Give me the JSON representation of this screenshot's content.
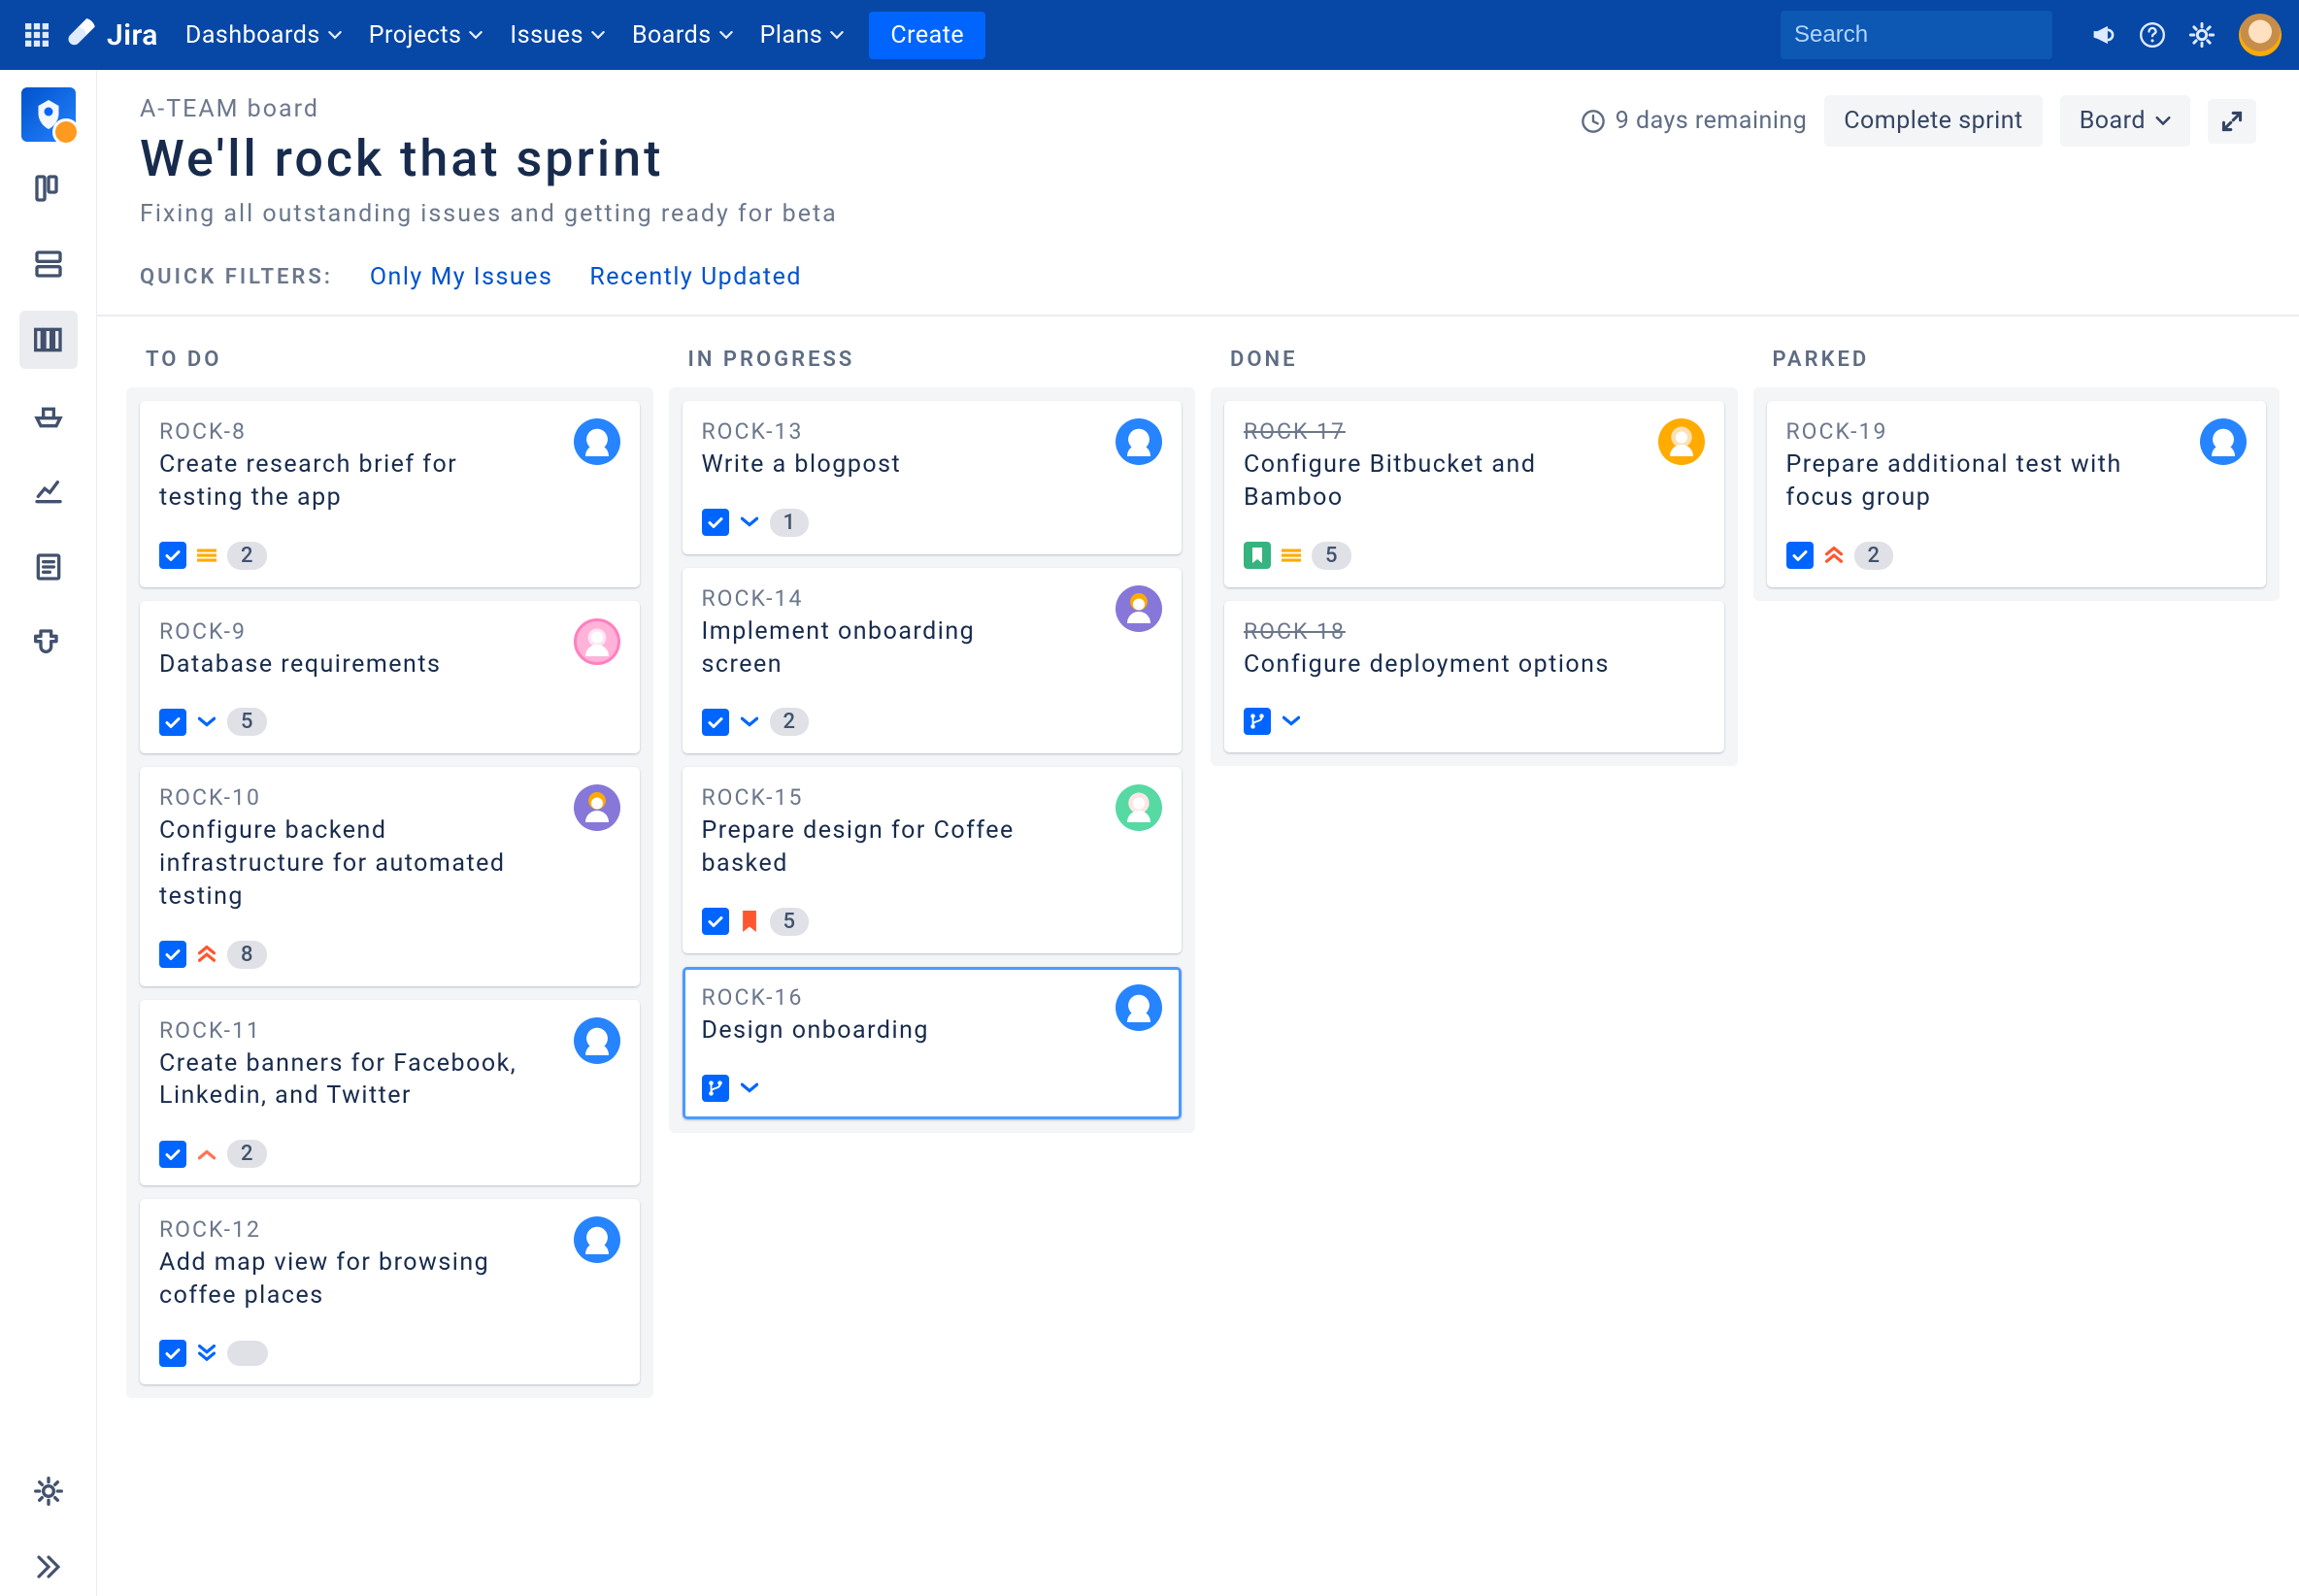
{
  "nav": {
    "brand": "Jira",
    "menu": [
      "Dashboards",
      "Projects",
      "Issues",
      "Boards",
      "Plans"
    ],
    "create": "Create",
    "search_placeholder": "Search"
  },
  "header": {
    "breadcrumb": "A-TEAM board",
    "title": "We'll rock that sprint",
    "subtitle": "Fixing all outstanding issues and getting ready for beta",
    "remaining": "9 days remaining",
    "complete_sprint": "Complete sprint",
    "board_btn": "Board"
  },
  "filters": {
    "label": "QUICK FILTERS:",
    "items": [
      "Only My Issues",
      "Recently Updated"
    ]
  },
  "columns": [
    {
      "title": "TO DO",
      "cards": [
        {
          "id": "ROCK-8",
          "title": "Create research brief for testing the app",
          "type": "task",
          "priority": "medium",
          "estimate": "2",
          "avatar": "blue"
        },
        {
          "id": "ROCK-9",
          "title": "Database requirements",
          "type": "task",
          "priority": "low",
          "estimate": "5",
          "avatar": "pink"
        },
        {
          "id": "ROCK-10",
          "title": "Configure backend infrastructure for automated testing",
          "type": "task",
          "priority": "highest",
          "estimate": "8",
          "avatar": "purple"
        },
        {
          "id": "ROCK-11",
          "title": "Create banners for Facebook, Linkedin, and Twitter",
          "type": "task",
          "priority": "high",
          "estimate": "2",
          "avatar": "blue"
        },
        {
          "id": "ROCK-12",
          "title": "Add map view for browsing coffee places",
          "type": "task",
          "priority": "lowest",
          "estimate": "",
          "avatar": "blue"
        }
      ]
    },
    {
      "title": "IN PROGRESS",
      "cards": [
        {
          "id": "ROCK-13",
          "title": "Write a blogpost",
          "type": "task",
          "priority": "low",
          "estimate": "1",
          "avatar": "blue"
        },
        {
          "id": "ROCK-14",
          "title": "Implement onboarding screen",
          "type": "task",
          "priority": "low",
          "estimate": "2",
          "avatar": "purple"
        },
        {
          "id": "ROCK-15",
          "title": "Prepare design for Coffee basked",
          "type": "task",
          "priority": "flag",
          "estimate": "5",
          "avatar": "green"
        },
        {
          "id": "ROCK-16",
          "title": "Design onboarding",
          "type": "subtask",
          "priority": "low",
          "estimate": null,
          "avatar": "blue",
          "selected": true
        }
      ]
    },
    {
      "title": "DONE",
      "cards": [
        {
          "id": "ROCK-17",
          "title": "Configure Bitbucket and Bamboo",
          "type": "story",
          "priority": "medium",
          "estimate": "5",
          "avatar": "pink2",
          "done": true
        },
        {
          "id": "ROCK-18",
          "title": "Configure deployment options",
          "type": "subtask",
          "priority": "low",
          "estimate": null,
          "avatar": null,
          "done": true
        }
      ]
    },
    {
      "title": "PARKED",
      "cards": [
        {
          "id": "ROCK-19",
          "title": "Prepare additional test with focus group",
          "type": "task",
          "priority": "highest",
          "estimate": "2",
          "avatar": "blue"
        }
      ]
    }
  ]
}
